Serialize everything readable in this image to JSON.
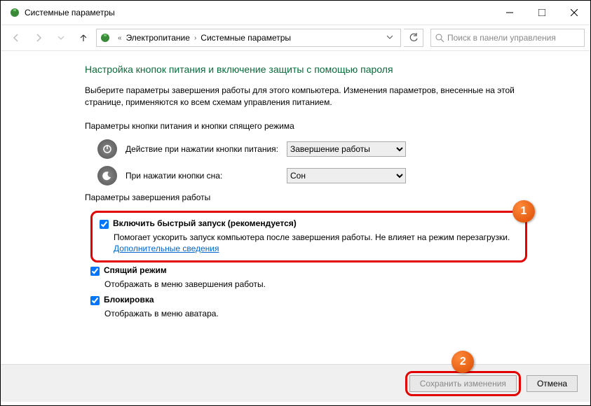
{
  "window": {
    "title": "Системные параметры"
  },
  "breadcrumb": {
    "c1": "Электропитание",
    "c2": "Системные параметры"
  },
  "search": {
    "placeholder": "Поиск в панели управления"
  },
  "main": {
    "heading": "Настройка кнопок питания и включение защиты с помощью пароля",
    "desc": "Выберите параметры завершения работы для этого компьютера. Изменения параметров, внесенные на этой странице, применяются ко всем схемам управления питанием.",
    "section1": "Параметры кнопки питания и кнопки спящего режима",
    "row1_label": "Действие при нажатии кнопки питания:",
    "row1_value": "Завершение работы",
    "row2_label": "При нажатии кнопки сна:",
    "row2_value": "Сон",
    "section2": "Параметры завершения работы",
    "fast_title": "Включить быстрый запуск (рекомендуется)",
    "fast_desc": "Помогает ускорить запуск компьютера после завершения работы. Не влияет на режим перезагрузки. ",
    "fast_link": "Дополнительные сведения",
    "sleep_title": "Спящий режим",
    "sleep_desc": "Отображать в меню завершения работы.",
    "lock_title": "Блокировка",
    "lock_desc": "Отображать в меню аватара."
  },
  "buttons": {
    "save": "Сохранить изменения",
    "cancel": "Отмена"
  },
  "badges": {
    "one": "1",
    "two": "2"
  }
}
